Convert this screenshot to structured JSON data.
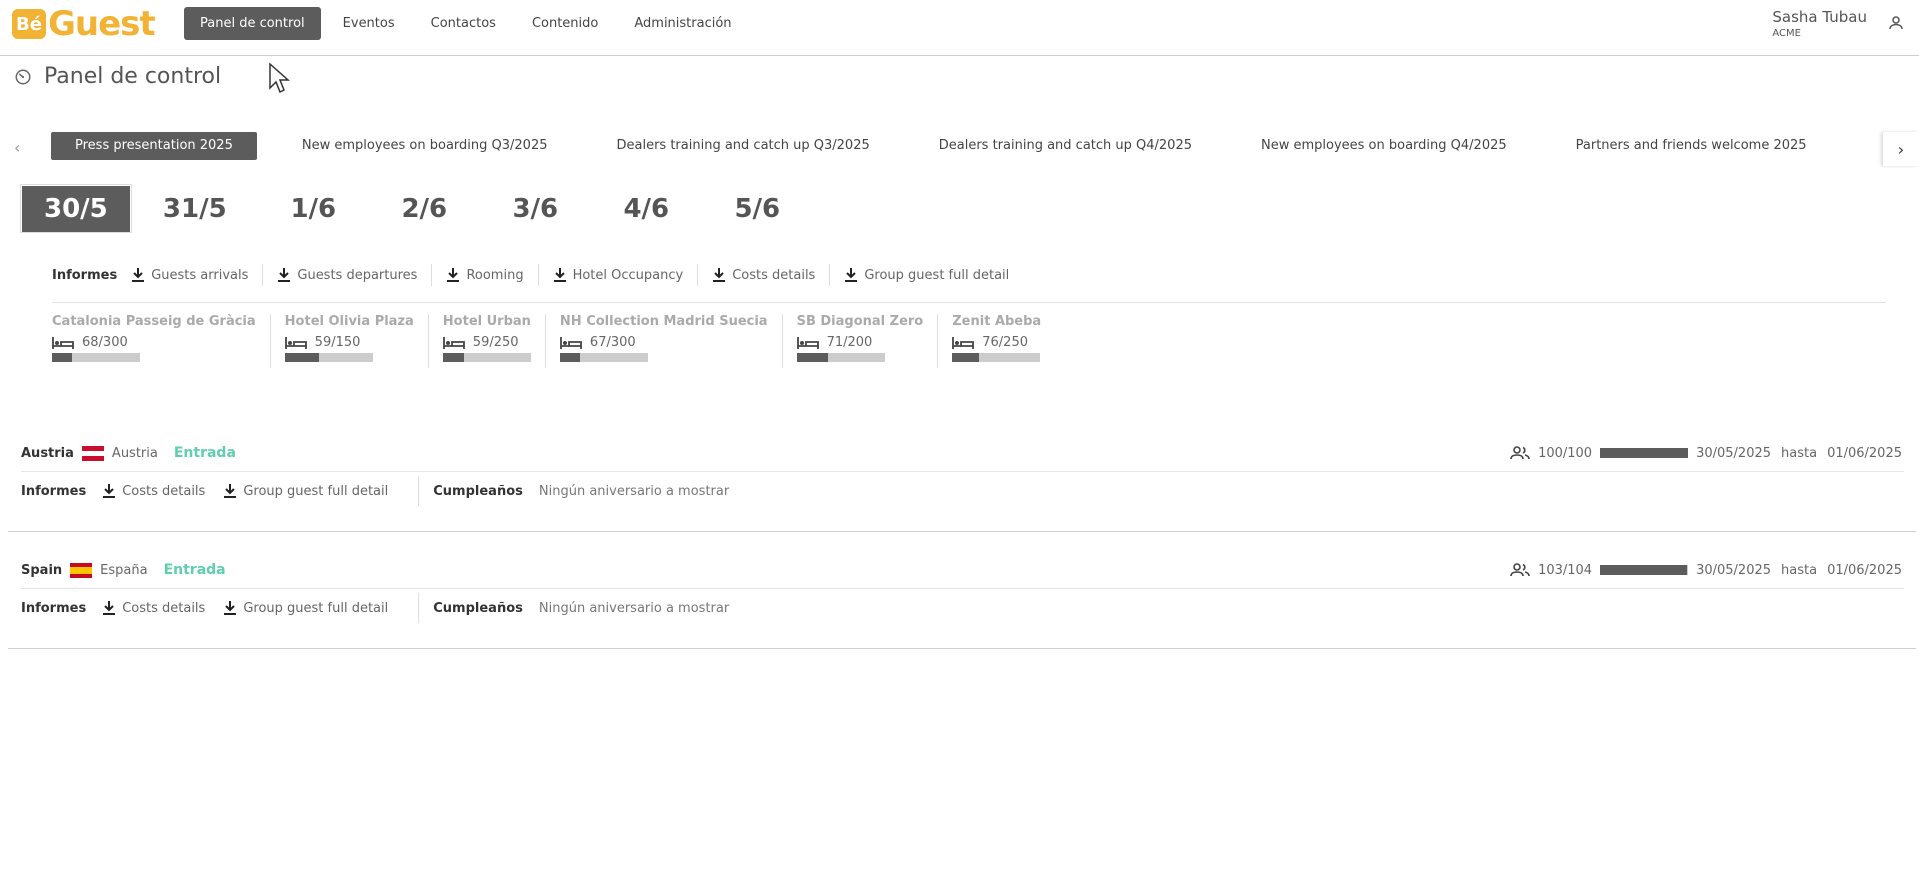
{
  "app": {
    "logo_be": "Bé",
    "logo_guest": "Guest",
    "brand_color": "#f2b233"
  },
  "nav": {
    "items": [
      {
        "label": "Panel de control",
        "active": true
      },
      {
        "label": "Eventos"
      },
      {
        "label": "Contactos"
      },
      {
        "label": "Contenido"
      },
      {
        "label": "Administración"
      }
    ]
  },
  "user": {
    "name": "Sasha Tubau",
    "org": "ACME",
    "icon": "user-icon"
  },
  "page": {
    "title": "Panel de control",
    "icon": "gauge-icon"
  },
  "events": {
    "tabs": [
      {
        "label": "Press presentation 2025",
        "active": true
      },
      {
        "label": "New employees on boarding Q3/2025"
      },
      {
        "label": "Dealers training and catch up Q3/2025"
      },
      {
        "label": "Dealers training and catch up Q4/2025"
      },
      {
        "label": "New employees on boarding Q4/2025"
      },
      {
        "label": "Partners and friends welcome 2025"
      }
    ]
  },
  "dates": {
    "tabs": [
      {
        "label": "30/5",
        "active": true
      },
      {
        "label": "31/5"
      },
      {
        "label": "1/6"
      },
      {
        "label": "2/6"
      },
      {
        "label": "3/6"
      },
      {
        "label": "4/6"
      },
      {
        "label": "5/6"
      }
    ]
  },
  "reports": {
    "label": "Informes",
    "items": [
      "Guests arrivals",
      "Guests departures",
      "Rooming",
      "Hotel Occupancy",
      "Costs details",
      "Group guest full detail"
    ]
  },
  "hotels": [
    {
      "name": "Catalonia Passeig de Gràcia",
      "count": "68/300",
      "occupancy": 0.227
    },
    {
      "name": "Hotel Olivia Plaza",
      "count": "59/150",
      "occupancy": 0.393
    },
    {
      "name": "Hotel Urban",
      "count": "59/250",
      "occupancy": 0.236
    },
    {
      "name": "NH Collection Madrid Suecia",
      "count": "67/300",
      "occupancy": 0.223
    },
    {
      "name": "SB Diagonal Zero",
      "count": "71/200",
      "occupancy": 0.355
    },
    {
      "name": "Zenit Abeba",
      "count": "76/250",
      "occupancy": 0.304
    }
  ],
  "groups": [
    {
      "name": "Austria",
      "country": "Austria",
      "status": "Entrada",
      "guests": "100/100",
      "fill": 1.0,
      "from": "30/05/2025",
      "hasta": "hasta",
      "to": "01/06/2025",
      "reports_label": "Informes",
      "reports": [
        "Costs details",
        "Group guest full detail"
      ],
      "bday_label": "Cumpleaños",
      "bday_text": "Ningún aniversario a mostrar"
    },
    {
      "name": "Spain",
      "country": "España",
      "status": "Entrada",
      "guests": "103/104",
      "fill": 0.99,
      "from": "30/05/2025",
      "hasta": "hasta",
      "to": "01/06/2025",
      "reports_label": "Informes",
      "reports": [
        "Costs details",
        "Group guest full detail"
      ],
      "bday_label": "Cumpleaños",
      "bday_text": "Ningún aniversario a mostrar"
    }
  ],
  "colors": {
    "active_tab": "#5c5c5c",
    "status_entrada": "#5fcfb0",
    "bar_empty": "#cccccc"
  }
}
